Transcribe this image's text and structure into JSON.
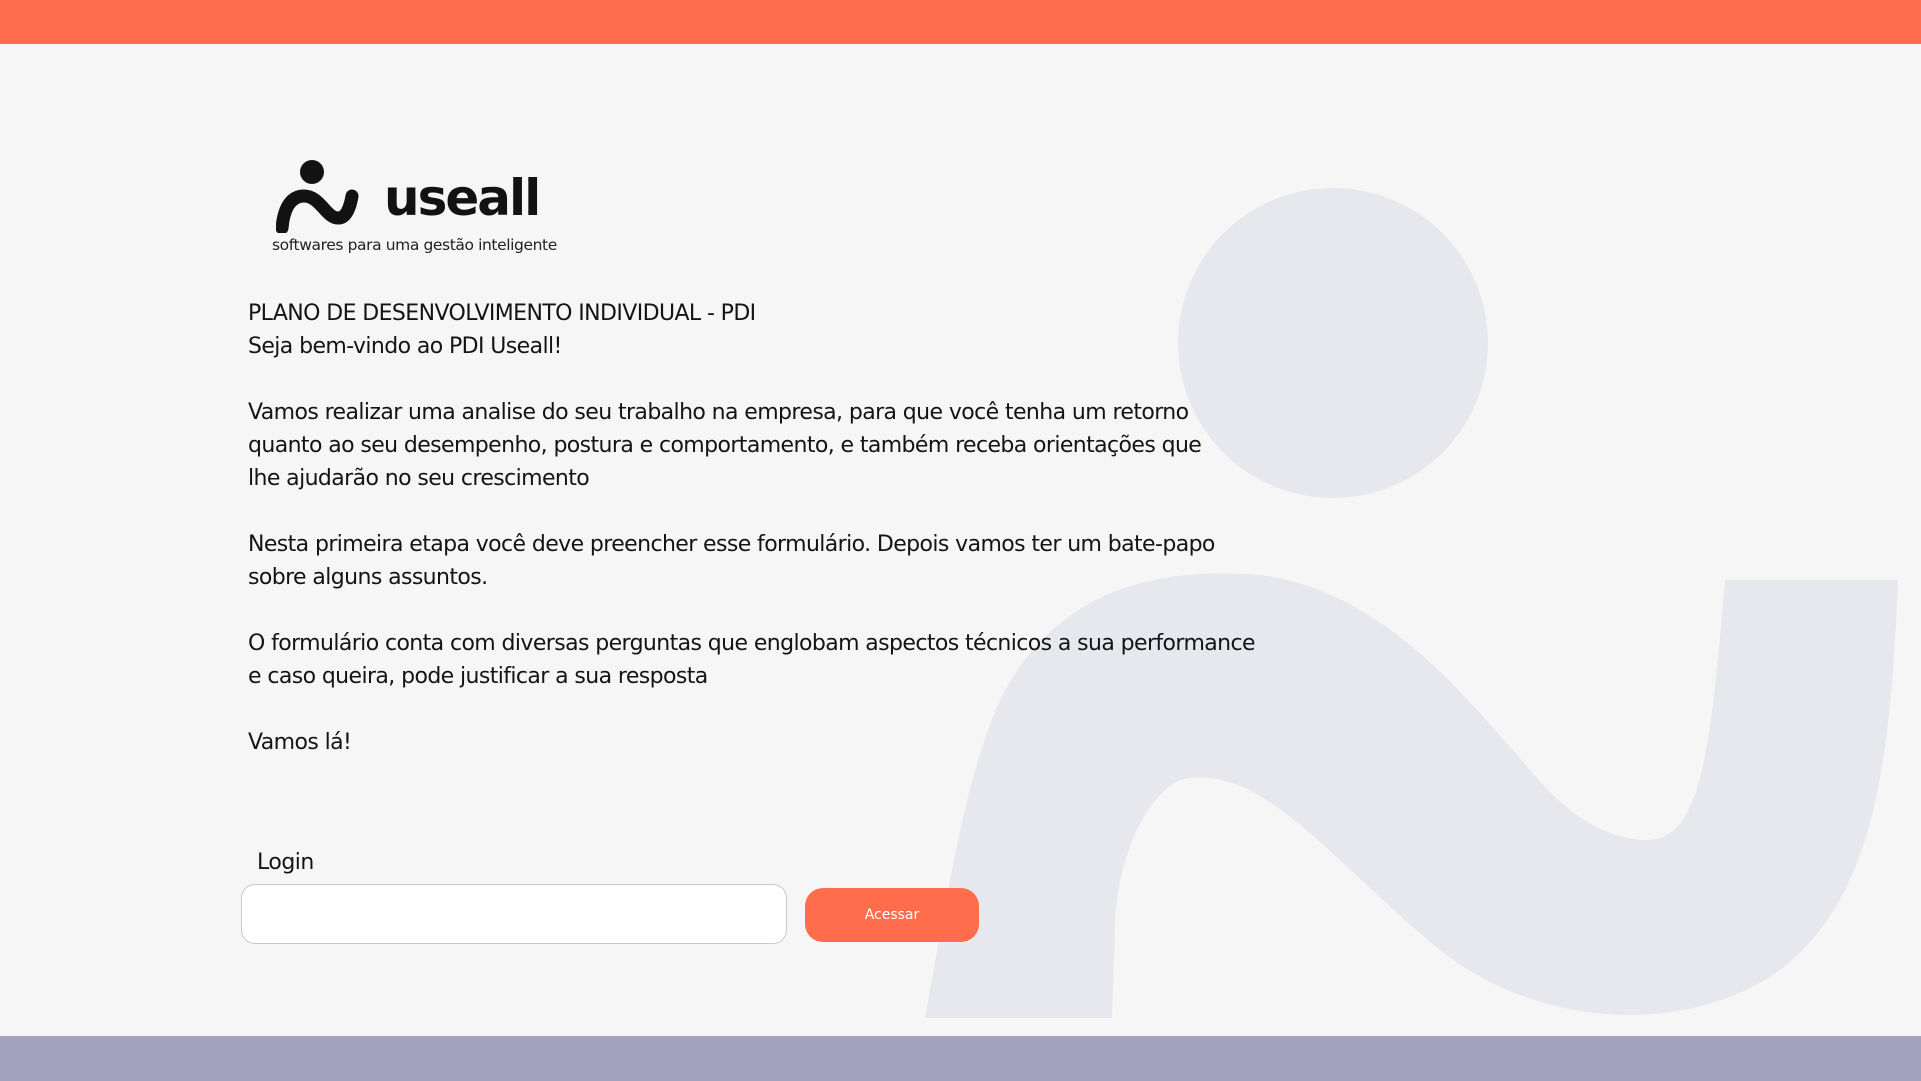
{
  "brand": {
    "name": "useall",
    "tagline": "softwares para uma gestão inteligente",
    "colors": {
      "accent": "#ff6d4d",
      "footer": "#a3a3bf",
      "background": "#f6f6f6",
      "watermark": "#e7e8ee"
    }
  },
  "intro": {
    "title": "PLANO DE DESENVOLVIMENTO INDIVIDUAL - PDI",
    "welcome": "Seja bem-vindo ao PDI Useall!",
    "paragraph1_lines": [
      "Vamos realizar uma analise do seu trabalho na empresa, para que você tenha um retorno",
      "quanto ao seu desempenho, postura e comportamento, e também receba orientações que",
      "lhe ajudarão no seu crescimento"
    ],
    "paragraph2_lines": [
      "Nesta primeira etapa você deve preencher esse formulário. Depois vamos ter um bate-papo",
      "sobre alguns assuntos."
    ],
    "paragraph3_lines": [
      "O formulário conta com diversas perguntas que englobam aspectos técnicos a sua performance",
      "e caso queira, pode justificar a sua resposta"
    ],
    "closing": "Vamos lá!"
  },
  "login": {
    "label": "Login",
    "value": "",
    "placeholder": "",
    "button_label": "Acessar"
  }
}
